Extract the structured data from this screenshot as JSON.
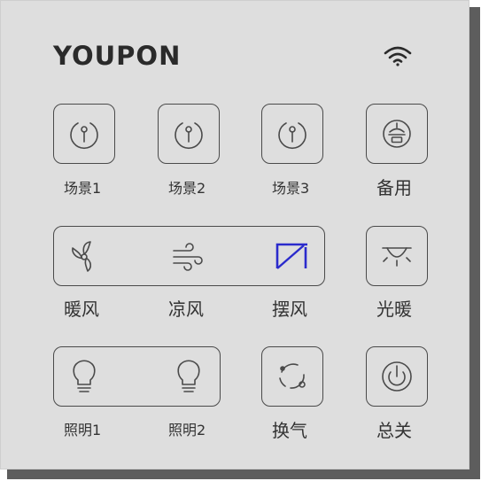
{
  "brand": {
    "name": "YOUPON"
  },
  "status": {
    "wifi_icon": "wifi-icon"
  },
  "colors": {
    "panel": "#dedede",
    "outline": "#4a4a4a",
    "text": "#333333",
    "active_swing": "#2b2bcc"
  },
  "row1": {
    "scene1": {
      "label": "场景1",
      "icon": "scene-icon"
    },
    "scene2": {
      "label": "场景2",
      "icon": "scene-icon"
    },
    "scene3": {
      "label": "场景3",
      "icon": "scene-icon"
    },
    "spare": {
      "label": "备用",
      "icon": "spare-icon"
    }
  },
  "row2": {
    "warm_air": {
      "label": "暖风",
      "icon": "fan-icon"
    },
    "cool_air": {
      "label": "凉风",
      "icon": "wind-icon"
    },
    "swing": {
      "label": "摆风",
      "icon": "swing-icon",
      "active": true
    },
    "light_heat": {
      "label": "光暖",
      "icon": "heat-lamp-icon"
    }
  },
  "row3": {
    "light1": {
      "label": "照明1",
      "icon": "bulb-icon"
    },
    "light2": {
      "label": "照明2",
      "icon": "bulb-icon"
    },
    "ventilation": {
      "label": "换气",
      "icon": "ventilation-icon"
    },
    "master": {
      "label": "总关",
      "icon": "power-icon"
    }
  }
}
